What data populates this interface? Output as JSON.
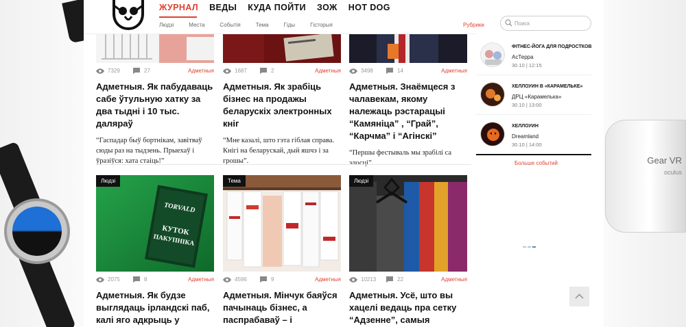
{
  "nav": {
    "main": [
      "ЖУРНАЛ",
      "ВЕДЫ",
      "КУДА ПОЙТИ",
      "ЗОЖ",
      "HOT DOG"
    ],
    "sub": [
      "Людзі",
      "Места",
      "Событія",
      "Тема",
      "Гіды",
      "Гісторыя"
    ],
    "rubriki": "Рубрики"
  },
  "search": {
    "placeholder": "Поиск",
    "value": ""
  },
  "articles": [
    {
      "views": "7329",
      "comments": "27",
      "rubric": "Адметныя",
      "title": "Адметныя. Як пабудаваць сабе ўтульную хатку за два тыдні і 10 тыс. даляраў",
      "lead": "“Гаспадар быў бортнікам, завітваў сюды раз на тыдзень. Прыехаў і ўразіўся: хата стаіць!”"
    },
    {
      "views": "1687",
      "comments": "2",
      "rubric": "Адметныя",
      "title": "Адметныя. Як зрабіць бізнес на продажы беларускіх электронных кніг",
      "lead": "“Мне казалі, што гэта гіблая справа. Кнігі на беларускай, дый яшчэ і за грошы”."
    },
    {
      "views": "3498",
      "comments": "14",
      "rubric": "Адметныя",
      "title": "Адметныя. Знаёмцеся з чалавекам, якому належаць рэстарацыі “Камяніца” , “Грай”, “Карчма” і “Агінскі”",
      "lead": "“Першы фестываль мы зрабілі са злосці”."
    },
    {
      "badge": "Людзі",
      "views": "2075",
      "comments": "8",
      "rubric": "Адметныя",
      "title": "Адметныя. Як будзе выглядаць ірландскі паб, калі яго адкрыць у Віцебску",
      "lead": ""
    },
    {
      "badge": "Тема",
      "views": "4596",
      "comments": "9",
      "rubric": "Адметныя",
      "title": "Адметныя. Мінчук баяўся пачынаць бізнес, а паспрабаваў – і атрымалася",
      "lead": ""
    },
    {
      "badge": "Людзі",
      "views": "10213",
      "comments": "22",
      "rubric": "Адметныя",
      "title": "Адметныя. Усё, што вы хацелі ведаць пра сетку “Адзенне”, самыя вядомыя",
      "lead": ""
    }
  ],
  "book_cover": {
    "brand": "TORVALD",
    "title_top": "КУТОК",
    "title_bottom": "ПАКУПНІКА"
  },
  "events": [
    {
      "title": "ФІТНЕС-ЙОГА ДЛЯ ПОДРОСТКОВ",
      "place": "АсТерра",
      "time": "30.10 | 12:15"
    },
    {
      "title": "ХЕЛЛОУИН В «КАРАМЕЛЬКЕ»",
      "place": "ДРЦ «Карамелька»",
      "time": "30.10 | 13:00"
    },
    {
      "title": "ХЕЛЛОУИН",
      "place": "Dreamland",
      "time": "30.10 | 14:00"
    }
  ],
  "more_events": "Больше событий",
  "ad": {
    "vr_label": "Gear VR",
    "vr_sub": "oculus"
  },
  "colors": {
    "accent": "#e0402f",
    "text": "#111111",
    "muted": "#999999"
  }
}
